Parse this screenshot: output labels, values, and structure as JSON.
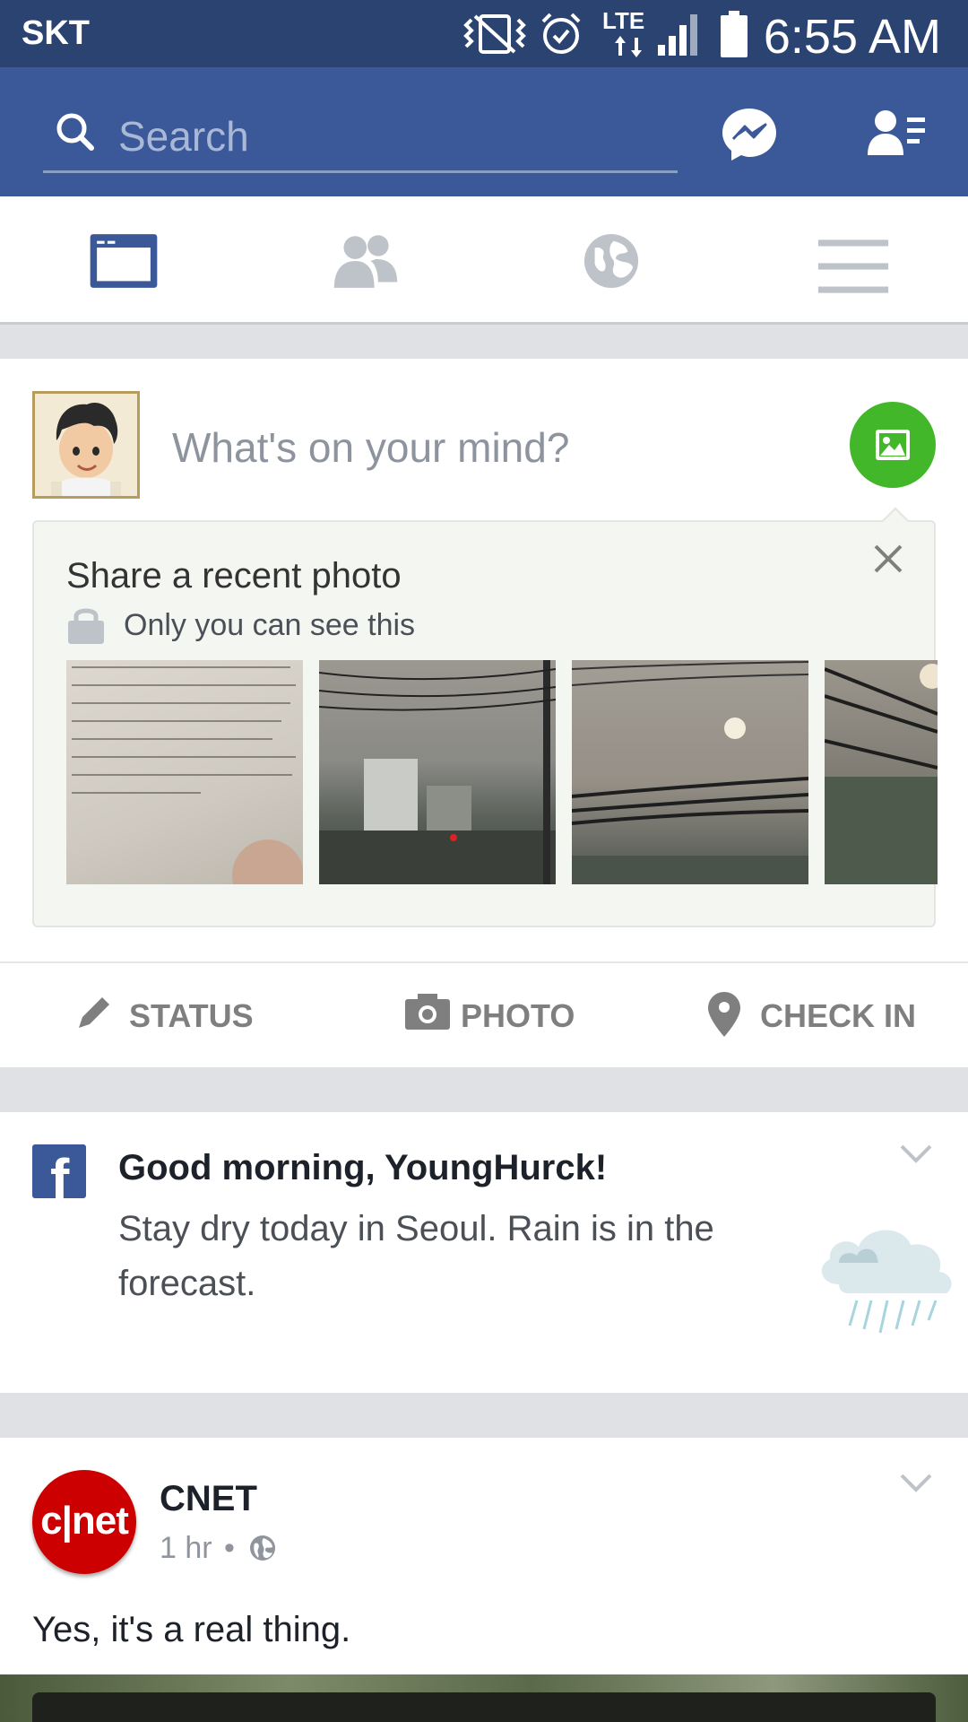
{
  "status_bar": {
    "carrier": "SKT",
    "network": "LTE",
    "time": "6:55 AM"
  },
  "header": {
    "search_placeholder": "Search"
  },
  "tabs": [
    {
      "name": "news-feed",
      "active": true
    },
    {
      "name": "friends",
      "active": false
    },
    {
      "name": "notifications",
      "active": false
    },
    {
      "name": "menu",
      "active": false
    }
  ],
  "composer": {
    "placeholder": "What's on your mind?"
  },
  "share_photo": {
    "title": "Share a recent photo",
    "privacy": "Only you can see this"
  },
  "actions": [
    {
      "label": "STATUS",
      "icon": "pencil-icon"
    },
    {
      "label": "PHOTO",
      "icon": "camera-icon"
    },
    {
      "label": "CHECK IN",
      "icon": "location-pin-icon"
    }
  ],
  "greeting": {
    "headline": "Good morning, YoungHurck!",
    "message": "Stay dry today in Seoul. Rain is in the forecast."
  },
  "post": {
    "author": "CNET",
    "time": "1 hr",
    "text": "Yes, it's a real thing."
  },
  "colors": {
    "brand": "#3b5998",
    "status_bar": "#2b4370",
    "fab": "#42b72a"
  }
}
